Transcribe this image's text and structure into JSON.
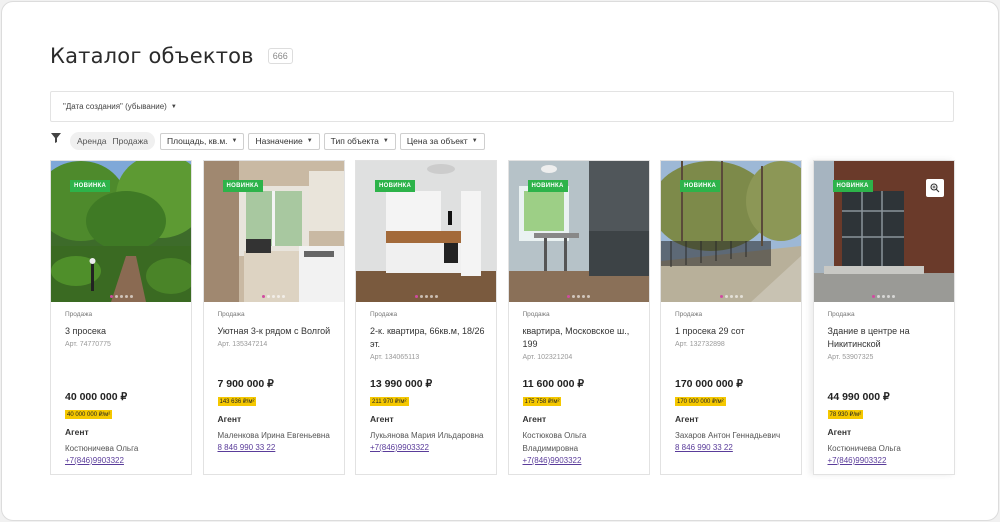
{
  "header": {
    "title": "Каталог объектов",
    "count": "666"
  },
  "sort": {
    "label": "\"Дата создания\" (убывание)"
  },
  "filters": {
    "deal_types": [
      "Аренда",
      "Продажа"
    ],
    "selects": [
      "Площадь, кв.м.",
      "Назначение",
      "Тип объекта",
      "Цена за объект"
    ]
  },
  "cards": [
    {
      "badge": "НОВИНКА",
      "deal": "Продажа",
      "title": "3 просека",
      "art": "Арт. 74770775",
      "price": "40 000 000 ₽",
      "price_m2": "40 000 000 ₽/м²",
      "agent_label": "Агент",
      "agent": "Костюничева Ольга",
      "phone": "+7(846)9903322"
    },
    {
      "badge": "НОВИНКА",
      "deal": "Продажа",
      "title": "Уютная 3-к рядом с Волгой",
      "art": "Арт. 135347214",
      "price": "7 900 000 ₽",
      "price_m2": "143 636 ₽/м²",
      "agent_label": "Агент",
      "agent": "Маленкова Ирина Евгеньевна",
      "phone": "8 846 990 33 22"
    },
    {
      "badge": "НОВИНКА",
      "deal": "Продажа",
      "title": "2-к. квартира, 66кв.м, 18/26 эт.",
      "art": "Арт. 134065113",
      "price": "13 990 000 ₽",
      "price_m2": "211 970 ₽/м²",
      "agent_label": "Агент",
      "agent": "Лукьянова Мария Ильдаровна",
      "phone": "+7(846)9903322"
    },
    {
      "badge": "НОВИНКА",
      "deal": "Продажа",
      "title": "квартира, Московское ш., 199",
      "art": "Арт. 102321204",
      "price": "11 600 000 ₽",
      "price_m2": "175 758 ₽/м²",
      "agent_label": "Агент",
      "agent": "Костюкова Ольга Владимировна",
      "phone": "+7(846)9903322"
    },
    {
      "badge": "НОВИНКА",
      "deal": "Продажа",
      "title": "1 просека 29 сот",
      "art": "Арт. 132732898",
      "price": "170 000 000 ₽",
      "price_m2": "170 000 000 ₽/м²",
      "agent_label": "Агент",
      "agent": "Захаров Антон Геннадьевич",
      "phone": "8 846 990 33 22"
    },
    {
      "badge": "НОВИНКА",
      "deal": "Продажа",
      "title": "Здание в центре на Никитинской",
      "art": "Арт. 53907325",
      "price": "44 990 000 ₽",
      "price_m2": "78 930 ₽/м²",
      "agent_label": "Агент",
      "agent": "Костюничева Ольга",
      "phone": "+7(846)9903322"
    }
  ],
  "colors": {
    "badge_green": "#2db34a",
    "price_m2_yellow": "#f5c800",
    "phone_purple": "#5a3c9a"
  }
}
